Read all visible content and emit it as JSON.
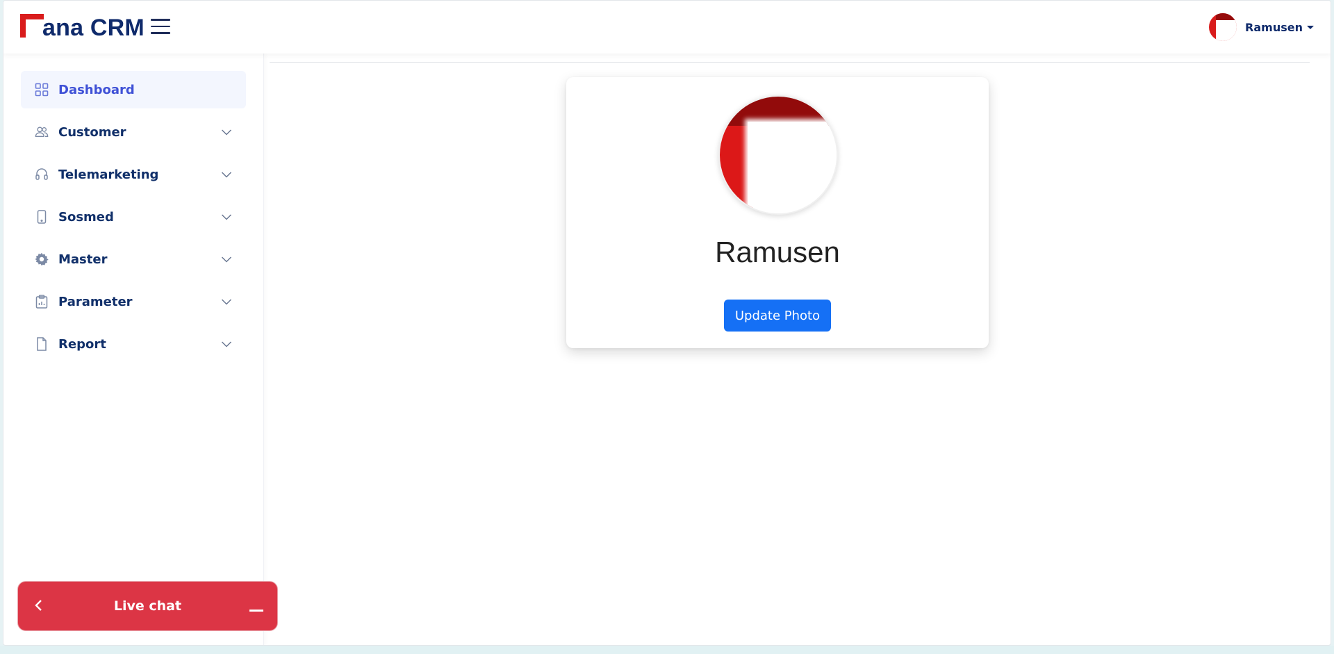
{
  "brand": {
    "name": "ana CRM",
    "accent": "#d91c1c",
    "text_color": "#0f2a6b"
  },
  "header": {
    "user_name": "Ramusen"
  },
  "sidebar": {
    "items": [
      {
        "label": "Dashboard",
        "icon": "grid-icon",
        "active": true,
        "expandable": false
      },
      {
        "label": "Customer",
        "icon": "users-icon",
        "expandable": true
      },
      {
        "label": "Telemarketing",
        "icon": "headset-icon",
        "expandable": true
      },
      {
        "label": "Sosmed",
        "icon": "phone-icon",
        "expandable": true
      },
      {
        "label": "Master",
        "icon": "gear-icon",
        "expandable": true
      },
      {
        "label": "Parameter",
        "icon": "clipboard-icon",
        "expandable": true
      },
      {
        "label": "Report",
        "icon": "document-icon",
        "expandable": true
      }
    ]
  },
  "profile": {
    "name": "Ramusen",
    "update_button": "Update Photo"
  },
  "livechat": {
    "title": "Live chat",
    "color": "#dc3545"
  }
}
